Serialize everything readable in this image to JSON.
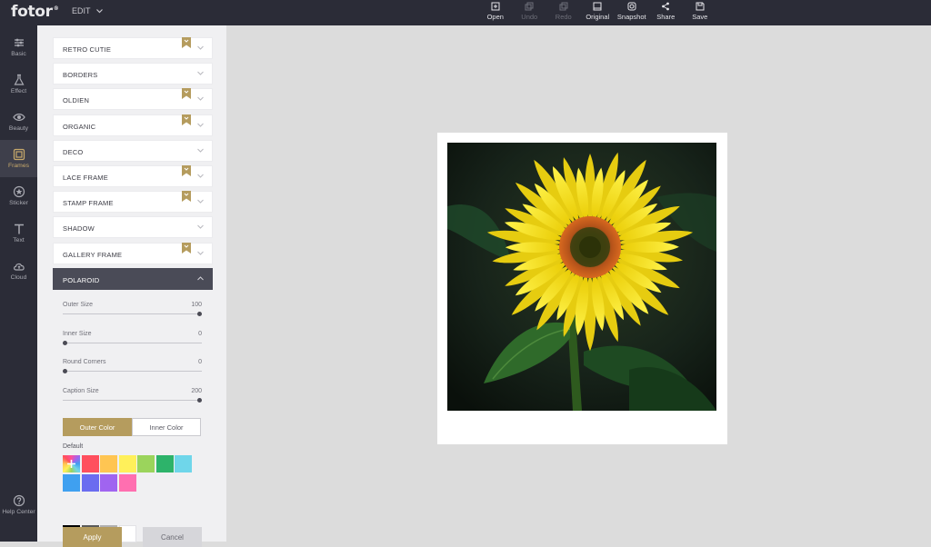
{
  "app": {
    "logo": "fotor",
    "logo_mark": "®",
    "edit_menu": "EDIT"
  },
  "toolbar": [
    {
      "label": "Open",
      "icon": "open-icon",
      "enabled": true
    },
    {
      "label": "Undo",
      "icon": "undo-icon",
      "enabled": false
    },
    {
      "label": "Redo",
      "icon": "redo-icon",
      "enabled": false
    },
    {
      "label": "Original",
      "icon": "original-icon",
      "enabled": true
    },
    {
      "label": "Snapshot",
      "icon": "snapshot-icon",
      "enabled": true
    },
    {
      "label": "Share",
      "icon": "share-icon",
      "enabled": true
    },
    {
      "label": "Save",
      "icon": "save-icon",
      "enabled": true
    }
  ],
  "nav": [
    {
      "label": "Basic",
      "icon": "sliders-icon",
      "active": false
    },
    {
      "label": "Effect",
      "icon": "flask-icon",
      "active": false
    },
    {
      "label": "Beauty",
      "icon": "eye-icon",
      "active": false
    },
    {
      "label": "Frames",
      "icon": "frame-icon",
      "active": true
    },
    {
      "label": "Sticker",
      "icon": "sticker-icon",
      "active": false
    },
    {
      "label": "Text",
      "icon": "text-icon",
      "active": false
    },
    {
      "label": "Cloud",
      "icon": "cloud-icon",
      "active": false
    },
    {
      "label": "Help Center",
      "icon": "help-icon",
      "active": false
    }
  ],
  "frame_categories": [
    {
      "label": "RETRO CUTIE",
      "premium": true,
      "open": false
    },
    {
      "label": "BORDERS",
      "premium": false,
      "open": false
    },
    {
      "label": "OLDIEN",
      "premium": true,
      "open": false
    },
    {
      "label": "ORGANIC",
      "premium": true,
      "open": false
    },
    {
      "label": "DECO",
      "premium": false,
      "open": false
    },
    {
      "label": "LACE FRAME",
      "premium": true,
      "open": false
    },
    {
      "label": "STAMP FRAME",
      "premium": true,
      "open": false
    },
    {
      "label": "SHADOW",
      "premium": false,
      "open": false
    },
    {
      "label": "GALLERY FRAME",
      "premium": true,
      "open": false
    },
    {
      "label": "POLAROID",
      "premium": false,
      "open": true
    }
  ],
  "sliders": [
    {
      "label": "Outer Size",
      "value": "100",
      "fraction": 1.0
    },
    {
      "label": "Inner Size",
      "value": "0",
      "fraction": 0.0
    },
    {
      "label": "Round Corners",
      "value": "0",
      "fraction": 0.0
    },
    {
      "label": "Caption Size",
      "value": "200",
      "fraction": 1.0
    }
  ],
  "color_tabs": {
    "outer": "Outer Color",
    "inner": "Inner Color",
    "active": "outer"
  },
  "palette": {
    "label": "Default",
    "colors": [
      "#ff4f5e",
      "#ffc552",
      "#fff05a",
      "#9bd45c",
      "#2db36a",
      "#6fd6ea",
      "#3fa0f0",
      "#6a6cf0",
      "#a064f0",
      "#ff6fb0"
    ],
    "grays": [
      "#000000",
      "#5a5a5a",
      "#b0b0b0",
      "#ffffff"
    ]
  },
  "buttons": {
    "apply": "Apply",
    "cancel": "Cancel"
  }
}
